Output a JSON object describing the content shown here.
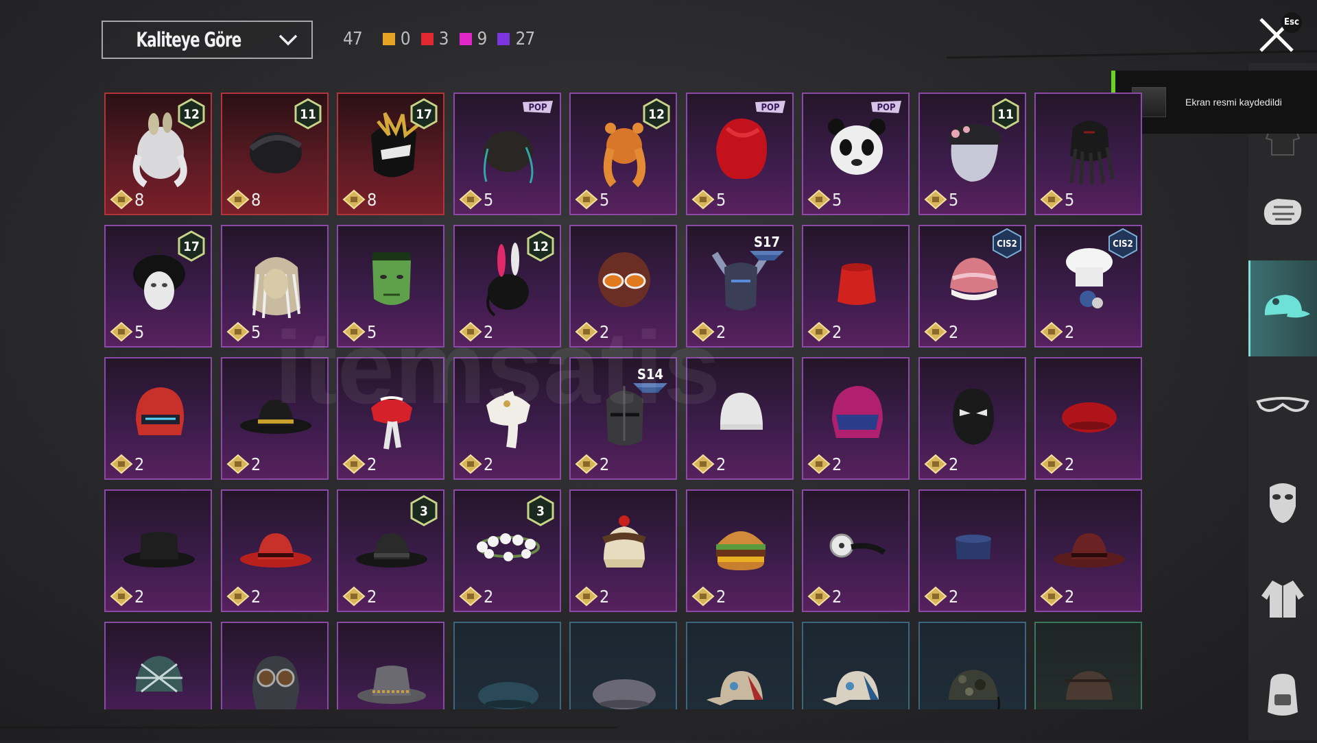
{
  "header": {
    "sort_label": "Kaliteye Göre",
    "total_count": "47",
    "quality_counts": [
      {
        "color": "#e8a224",
        "count": "0"
      },
      {
        "color": "#e0282e",
        "count": "3"
      },
      {
        "color": "#e127c8",
        "count": "9"
      },
      {
        "color": "#7a35e0",
        "count": "27"
      }
    ],
    "esc_label": "Esc"
  },
  "toast": {
    "message": "Ekran resmi kaydedildi"
  },
  "sidebar": {
    "items": [
      {
        "icon": "outfit-icon",
        "active": false
      },
      {
        "icon": "glove-icon",
        "active": false
      },
      {
        "icon": "cap-icon",
        "active": true
      },
      {
        "icon": "glasses-icon",
        "active": false
      },
      {
        "icon": "mask-icon",
        "active": false
      },
      {
        "icon": "jacket-icon",
        "active": false
      },
      {
        "icon": "backpack-icon",
        "active": false
      }
    ]
  },
  "watermark": "itemsatis",
  "items": [
    {
      "name": "white-bunny-hair",
      "quality": "red",
      "cost": "8",
      "badge": "12",
      "art": "hair-white"
    },
    {
      "name": "black-spiky-hair",
      "quality": "red",
      "cost": "8",
      "badge": "11",
      "art": "hair-black"
    },
    {
      "name": "gold-helmet",
      "quality": "red",
      "cost": "8",
      "badge": "17",
      "art": "helmet-gold"
    },
    {
      "name": "dark-hair-teal-ribbon",
      "quality": "purple",
      "cost": "5",
      "badge": "POP",
      "art": "hair-dark"
    },
    {
      "name": "orange-pigtails",
      "quality": "purple",
      "cost": "5",
      "badge": "12",
      "art": "hair-orange"
    },
    {
      "name": "red-hair",
      "quality": "purple",
      "cost": "5",
      "badge": "POP",
      "art": "hair-red"
    },
    {
      "name": "panda-head",
      "quality": "purple",
      "cost": "5",
      "badge": "POP",
      "art": "panda"
    },
    {
      "name": "flower-silver-hair",
      "quality": "purple",
      "cost": "5",
      "badge": "11",
      "art": "hair-silver"
    },
    {
      "name": "dreadlock-mask",
      "quality": "purple",
      "cost": "5",
      "badge": "",
      "art": "predator"
    },
    {
      "name": "black-knight-helmet",
      "quality": "purple",
      "cost": "5",
      "badge": "17",
      "art": "helmet-black"
    },
    {
      "name": "lion-mane",
      "quality": "purple",
      "cost": "5",
      "badge": "",
      "art": "lion"
    },
    {
      "name": "frankenstein-mask",
      "quality": "purple",
      "cost": "5",
      "badge": "",
      "art": "frank"
    },
    {
      "name": "bunny-helmet",
      "quality": "purple",
      "cost": "2",
      "badge": "12",
      "art": "bunny"
    },
    {
      "name": "goggles-hair",
      "quality": "purple",
      "cost": "2",
      "badge": "",
      "art": "goggles"
    },
    {
      "name": "horned-helmet",
      "quality": "purple",
      "cost": "2",
      "badge": "S17",
      "art": "horned"
    },
    {
      "name": "red-fez",
      "quality": "purple",
      "cost": "2",
      "badge": "",
      "art": "fez"
    },
    {
      "name": "donut-beanie",
      "quality": "purple",
      "cost": "2",
      "badge": "CIS2",
      "art": "donut"
    },
    {
      "name": "chef-hat",
      "quality": "purple",
      "cost": "2",
      "badge": "CIS2",
      "art": "chef"
    },
    {
      "name": "red-visor-helmet",
      "quality": "purple",
      "cost": "2",
      "badge": "",
      "art": "helmet-red"
    },
    {
      "name": "black-gold-fedora",
      "quality": "purple",
      "cost": "2",
      "badge": "",
      "art": "fedora-gold"
    },
    {
      "name": "red-bandana",
      "quality": "purple",
      "cost": "2",
      "badge": "",
      "art": "bandana"
    },
    {
      "name": "white-turban",
      "quality": "purple",
      "cost": "2",
      "badge": "",
      "art": "turban"
    },
    {
      "name": "knight-helm",
      "quality": "purple",
      "cost": "2",
      "badge": "S14",
      "art": "knight"
    },
    {
      "name": "white-beanie",
      "quality": "purple",
      "cost": "2",
      "badge": "",
      "art": "beanie-white"
    },
    {
      "name": "magenta-helmet",
      "quality": "purple",
      "cost": "2",
      "badge": "",
      "art": "helmet-pink"
    },
    {
      "name": "black-luchador",
      "quality": "purple",
      "cost": "2",
      "badge": "",
      "art": "luchador"
    },
    {
      "name": "red-beret",
      "quality": "purple",
      "cost": "2",
      "badge": "",
      "art": "beret-red"
    },
    {
      "name": "black-bowler",
      "quality": "purple",
      "cost": "2",
      "badge": "",
      "art": "bowler-black"
    },
    {
      "name": "red-fedora",
      "quality": "purple",
      "cost": "2",
      "badge": "",
      "art": "fedora-red"
    },
    {
      "name": "black-fedora",
      "quality": "purple",
      "cost": "2",
      "badge": "3",
      "art": "fedora-black"
    },
    {
      "name": "flower-crown",
      "quality": "purple",
      "cost": "2",
      "badge": "3",
      "art": "flowers"
    },
    {
      "name": "sundae-hat",
      "quality": "purple",
      "cost": "2",
      "badge": "",
      "art": "sundae"
    },
    {
      "name": "burger-hat",
      "quality": "purple",
      "cost": "2",
      "badge": "",
      "art": "burger"
    },
    {
      "name": "head-mirror",
      "quality": "purple",
      "cost": "2",
      "badge": "",
      "art": "mirror"
    },
    {
      "name": "navy-cap",
      "quality": "purple",
      "cost": "2",
      "badge": "",
      "art": "navy-cap"
    },
    {
      "name": "maroon-fedora",
      "quality": "purple",
      "cost": "2",
      "badge": "",
      "art": "fedora-maroon"
    },
    {
      "name": "plaid-helmet",
      "quality": "purple",
      "cost": "",
      "badge": "",
      "art": "plaid"
    },
    {
      "name": "aviator-cap",
      "quality": "purple",
      "cost": "",
      "badge": "",
      "art": "aviator"
    },
    {
      "name": "bucket-hat",
      "quality": "purple",
      "cost": "",
      "badge": "",
      "art": "bucket"
    },
    {
      "name": "blue-beret",
      "quality": "blue",
      "cost": "",
      "badge": "",
      "art": "beret-blue"
    },
    {
      "name": "grey-beret",
      "quality": "blue",
      "cost": "",
      "badge": "",
      "art": "beret-grey"
    },
    {
      "name": "red-baseball-cap",
      "quality": "blue",
      "cost": "",
      "badge": "",
      "art": "cap-red"
    },
    {
      "name": "blue-baseball-cap",
      "quality": "blue",
      "cost": "",
      "badge": "",
      "art": "cap-blue"
    },
    {
      "name": "camo-cap",
      "quality": "blue",
      "cost": "",
      "badge": "",
      "art": "camo"
    },
    {
      "name": "brown-cap",
      "quality": "green",
      "cost": "",
      "badge": "",
      "art": "cap-brown"
    }
  ]
}
